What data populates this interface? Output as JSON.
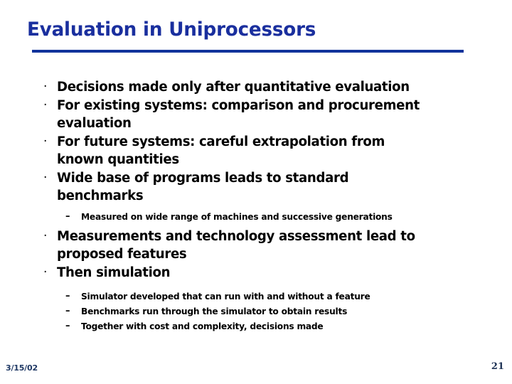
{
  "slide": {
    "title": "Evaluation in Uniprocessors",
    "title_color": "#1a2f9e",
    "rule_color": "#12339b",
    "background_color": "#ffffff",
    "body_text_color": "#000000",
    "markers": {
      "level1": "·",
      "level2": "–"
    },
    "bullets": [
      {
        "level": 1,
        "text": "Decisions made only after quantitative evaluation"
      },
      {
        "level": 1,
        "text": "For existing systems: comparison and procurement evaluation"
      },
      {
        "level": 1,
        "text": "For future systems: careful extrapolation from known quantities"
      },
      {
        "level": 1,
        "text": "Wide base of programs leads to standard benchmarks"
      },
      {
        "level": 2,
        "text": "Measured on wide range of machines and successive generations"
      },
      {
        "level": 1,
        "text": "Measurements and technology assessment lead to proposed features"
      },
      {
        "level": 1,
        "text": "Then simulation"
      },
      {
        "level": 2,
        "text": "Simulator developed that can run with and without a feature"
      },
      {
        "level": 2,
        "text": "Benchmarks run through the simulator to obtain results"
      },
      {
        "level": 2,
        "text": "Together with cost and complexity, decisions made"
      }
    ],
    "footer": {
      "date": "3/15/02",
      "page_number": "21",
      "footer_color": "#1f3864"
    }
  }
}
